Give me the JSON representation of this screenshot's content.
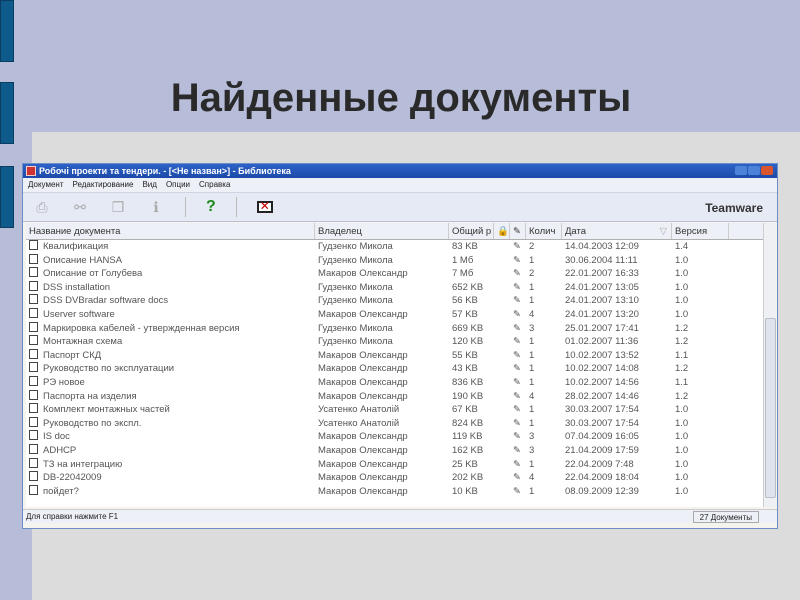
{
  "slide_title": "Найденные документы",
  "window": {
    "title": "Робочі проекти та тендери. - [<Не назван>] - Библиотека",
    "menu": [
      "Документ",
      "Редактирование",
      "Вид",
      "Опции",
      "Справка"
    ],
    "brand": "Teamware",
    "columns": [
      "Название документа",
      "Владелец",
      "Общий р",
      "",
      "",
      "Колич",
      "Дата",
      "Версия"
    ],
    "rows": [
      [
        "Квалификация",
        "Гудзенко Микола",
        "83 KB",
        "2",
        "14.04.2003 12:09",
        "1.4"
      ],
      [
        "Описание HANSA",
        "Гудзенко Микола",
        "1 Мб",
        "1",
        "30.06.2004 11:11",
        "1.0"
      ],
      [
        "Описание от Голубева",
        "Макаров Олександр",
        "7 Мб",
        "2",
        "22.01.2007 16:33",
        "1.0"
      ],
      [
        "DSS installation",
        "Гудзенко Микола",
        "652 KB",
        "1",
        "24.01.2007 13:05",
        "1.0"
      ],
      [
        "DSS DVBradar software docs",
        "Гудзенко Микола",
        "56 KB",
        "1",
        "24.01.2007 13:10",
        "1.0"
      ],
      [
        "Userver software",
        "Макаров Олександр",
        "57 KB",
        "4",
        "24.01.2007 13:20",
        "1.0"
      ],
      [
        "Маркировка кабелей - утвержденная версия",
        "Гудзенко Микола",
        "669 KB",
        "3",
        "25.01.2007 17:41",
        "1.2"
      ],
      [
        "Монтажная схема",
        "Гудзенко Микола",
        "120 KB",
        "1",
        "01.02.2007 11:36",
        "1.2"
      ],
      [
        "Паспорт СКД",
        "Макаров Олександр",
        "55 KB",
        "1",
        "10.02.2007 13:52",
        "1.1"
      ],
      [
        "Руководство по эксплуатации",
        "Макаров Олександр",
        "43 KB",
        "1",
        "10.02.2007 14:08",
        "1.2"
      ],
      [
        "РЭ новое",
        "Макаров Олександр",
        "836 KB",
        "1",
        "10.02.2007 14:56",
        "1.1"
      ],
      [
        "Паспорта на изделия",
        "Макаров Олександр",
        "190 KB",
        "4",
        "28.02.2007 14:46",
        "1.2"
      ],
      [
        "Комплект монтажных частей",
        "Усатенко Анатолій",
        "67 KB",
        "1",
        "30.03.2007 17:54",
        "1.0"
      ],
      [
        "Руководство по экспл.",
        "Усатенко Анатолій",
        "824 KB",
        "1",
        "30.03.2007 17:54",
        "1.0"
      ],
      [
        "IS doc",
        "Макаров Олександр",
        "119 KB",
        "3",
        "07.04.2009 16:05",
        "1.0"
      ],
      [
        "ADHCP",
        "Макаров Олександр",
        "162 KB",
        "3",
        "21.04.2009 17:59",
        "1.0"
      ],
      [
        "ТЗ на интеграцию",
        "Макаров Олександр",
        "25 KB",
        "1",
        "22.04.2009 7:48",
        "1.0"
      ],
      [
        "DB-22042009",
        "Макаров Олександр",
        "202 KB",
        "4",
        "22.04.2009 18:04",
        "1.0"
      ],
      [
        "пойдет?",
        "Макаров Олександр",
        "10 KB",
        "1",
        "08.09.2009 12:39",
        "1.0"
      ]
    ],
    "status_text": "Для справки нажмите F1",
    "doc_count": "27 Документы"
  }
}
